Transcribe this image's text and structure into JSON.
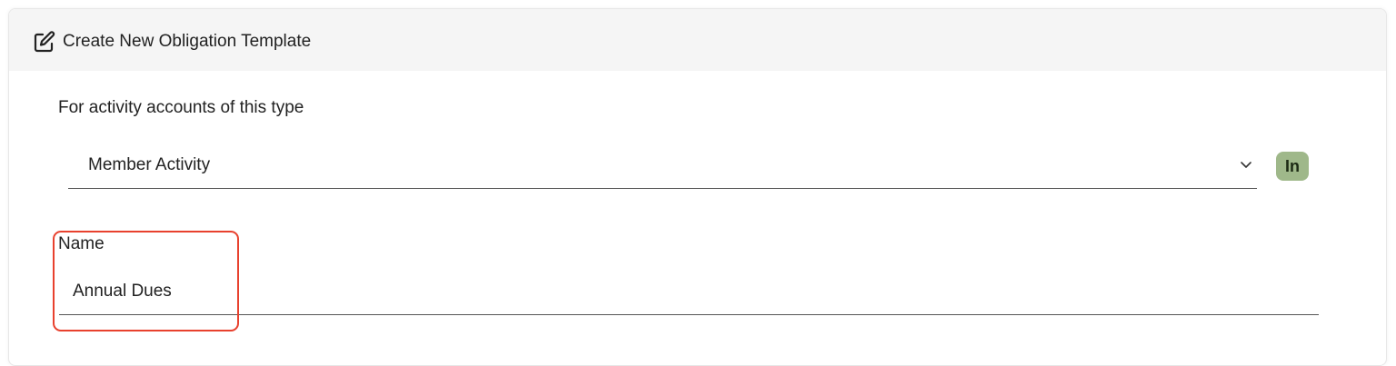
{
  "header": {
    "icon": "edit-icon",
    "title": "Create New Obligation Template"
  },
  "account_type": {
    "label": "For activity accounts of this type",
    "selected": "Member Activity",
    "badge": "In",
    "badge_color": "#9fb88a"
  },
  "name_field": {
    "label": "Name",
    "value": "Annual Dues"
  },
  "highlight_color": "#e8412e"
}
